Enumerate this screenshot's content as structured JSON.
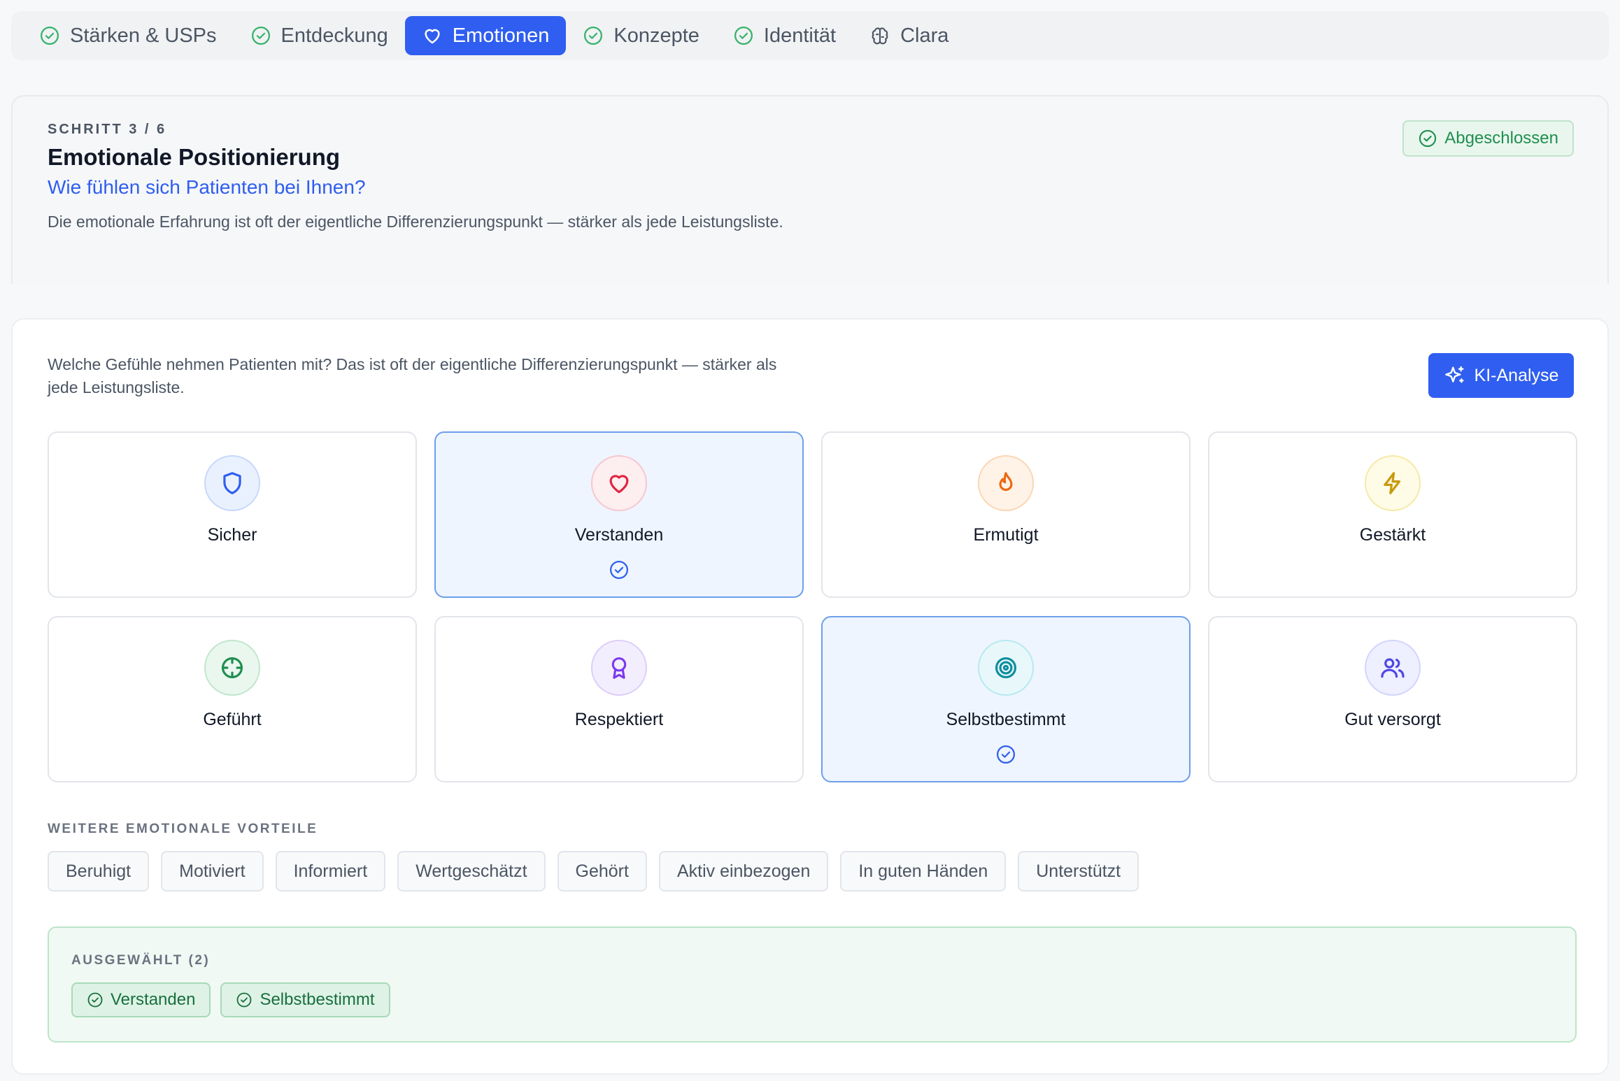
{
  "colors": {
    "accent": "#2f5ef0",
    "success": "#1f8f4e",
    "selected_bg": "#eef5fe"
  },
  "tabs": [
    {
      "label": "Stärken & USPs",
      "icon": "check-circle-icon",
      "active": false
    },
    {
      "label": "Entdeckung",
      "icon": "check-circle-icon",
      "active": false
    },
    {
      "label": "Emotionen",
      "icon": "heart-icon",
      "active": true
    },
    {
      "label": "Konzepte",
      "icon": "check-circle-icon",
      "active": false
    },
    {
      "label": "Identität",
      "icon": "check-circle-icon",
      "active": false
    },
    {
      "label": "Clara",
      "icon": "brain-icon",
      "active": false
    }
  ],
  "step": {
    "label": "SCHRITT 3 / 6",
    "title": "Emotionale Positionierung",
    "question": "Wie fühlen sich Patienten bei Ihnen?",
    "description": "Die emotionale Erfahrung ist oft der eigentliche Differenzierungspunkt — stärker als jede Leistungsliste.",
    "status": "Abgeschlossen"
  },
  "panel": {
    "intro": "Welche Gefühle nehmen Patienten mit? Das ist oft der eigentliche Differenzierungspunkt — stärker als jede Leistungsliste.",
    "ai_button": "KI-Analyse"
  },
  "emotions": [
    {
      "label": "Sicher",
      "icon": "shield-icon",
      "selected": false
    },
    {
      "label": "Verstanden",
      "icon": "heart-icon",
      "selected": true
    },
    {
      "label": "Ermutigt",
      "icon": "flame-icon",
      "selected": false
    },
    {
      "label": "Gestärkt",
      "icon": "lightning-icon",
      "selected": false
    },
    {
      "label": "Geführt",
      "icon": "compass-icon",
      "selected": false
    },
    {
      "label": "Respektiert",
      "icon": "award-icon",
      "selected": false
    },
    {
      "label": "Selbstbestimmt",
      "icon": "target-icon",
      "selected": true
    },
    {
      "label": "Gut versorgt",
      "icon": "users-icon",
      "selected": false
    }
  ],
  "more": {
    "label": "WEITERE EMOTIONALE VORTEILE",
    "chips": [
      "Beruhigt",
      "Motiviert",
      "Informiert",
      "Wertgeschätzt",
      "Gehört",
      "Aktiv einbezogen",
      "In guten Händen",
      "Unterstützt"
    ]
  },
  "selected": {
    "label": "AUSGEWÄHLT (2)",
    "items": [
      "Verstanden",
      "Selbstbestimmt"
    ]
  }
}
